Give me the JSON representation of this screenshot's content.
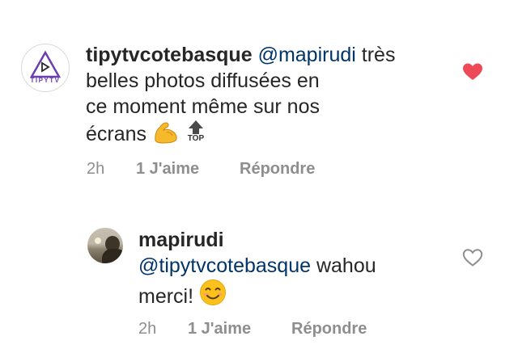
{
  "comments": [
    {
      "username": "tipytvcotebasque",
      "mention": "@mapirudi",
      "line1_rest": " très belles photos diffusées en",
      "line2": "ce moment même sur nos",
      "line3": "écrans",
      "emojis": [
        "flexed-biceps-emoji",
        "top-arrow-emoji"
      ],
      "top_label": "TOP",
      "time": "2h",
      "likes": "1 J'aime",
      "reply_label": "Répondre",
      "liked": true,
      "avatar_text": "TIPYTV"
    },
    {
      "username": "mapirudi",
      "mention": "@tipytvcotebasque",
      "line2_rest": " wahou",
      "line3": "merci!",
      "emojis": [
        "smiling-face-emoji"
      ],
      "time": "2h",
      "likes": "1 J'aime",
      "reply_label": "Répondre",
      "liked": false
    }
  ],
  "colors": {
    "heart_liked": "#ed4956",
    "heart_outline": "#8e8e8e",
    "mention": "#003569",
    "meta": "#8e8e8e",
    "brand": "#6a3fb0"
  }
}
